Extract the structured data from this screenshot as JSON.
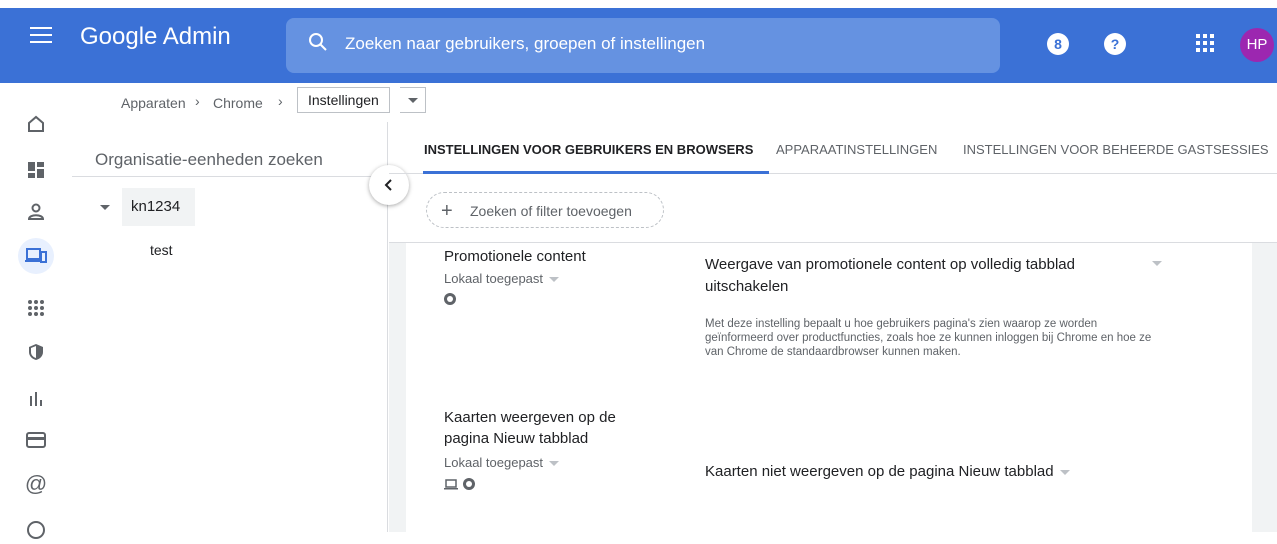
{
  "app": {
    "brand": "Google Admin"
  },
  "search": {
    "placeholder": "Zoeken naar gebruikers, groepen of instellingen"
  },
  "header": {
    "notif_badge": "8",
    "help_glyph": "?",
    "avatar_initials": "HP"
  },
  "breadcrumb": {
    "item1": "Apparaten",
    "item2": "Chrome",
    "current": "Instellingen",
    "separator": "›"
  },
  "org": {
    "search_placeholder": "Organisatie-eenheden zoeken",
    "root": "kn1234",
    "child": "test"
  },
  "tabs": [
    {
      "label": "INSTELLINGEN VOOR GEBRUIKERS EN BROWSERS",
      "active": true
    },
    {
      "label": "APPARAATINSTELLINGEN",
      "active": false
    },
    {
      "label": "INSTELLINGEN VOOR BEHEERDE GASTSESSIES",
      "active": false
    }
  ],
  "filter": {
    "label": "Zoeken of filter toevoegen"
  },
  "settings": [
    {
      "title": "Promotionele content",
      "scope": "Lokaal toegepast",
      "value": "Weergave van promotionele content op volledig tabblad uitschakelen",
      "description": "Met deze instelling bepaalt u hoe gebruikers pagina's zien waarop ze worden geïnformeerd over productfuncties, zoals hoe ze kunnen inloggen bij Chrome en hoe ze van Chrome de standaardbrowser kunnen maken."
    },
    {
      "title": "Kaarten weergeven op de pagina Nieuw tabblad",
      "scope": "Lokaal toegepast",
      "value": "Kaarten niet weergeven op de pagina Nieuw tabblad"
    }
  ],
  "colors": {
    "header_blue": "#3b71d6",
    "search_blue": "#6592e1",
    "avatar": "#9c27b0",
    "active_nav_bg": "#e8f0fe"
  }
}
